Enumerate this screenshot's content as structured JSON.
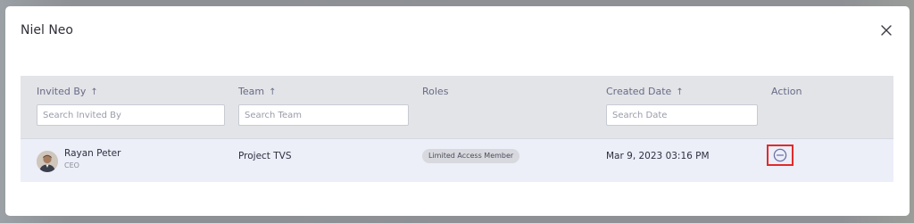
{
  "modal": {
    "title": "Niel Neo",
    "close_icon": "close-icon"
  },
  "table": {
    "columns": [
      {
        "label": "Invited By",
        "sortable": true,
        "sort_icon": "↑"
      },
      {
        "label": "Team",
        "sortable": true,
        "sort_icon": "↑"
      },
      {
        "label": "Roles",
        "sortable": false
      },
      {
        "label": "Created Date",
        "sortable": true,
        "sort_icon": "↑"
      },
      {
        "label": "Action",
        "sortable": false
      }
    ],
    "filters": {
      "invited_by_placeholder": "Search Invited By",
      "team_placeholder": "Search Team",
      "date_placeholder": "Search Date"
    },
    "rows": [
      {
        "name": "Rayan Peter",
        "title": "CEO",
        "team": "Project TVS",
        "role": "Limited Access Member",
        "created": "Mar 9, 2023 03:16 PM",
        "action_icon": "remove-circle-icon"
      }
    ]
  },
  "colors": {
    "header_bg": "#e3e4e8",
    "row_bg": "#eceef8",
    "highlight": "#e02b2b",
    "accent_icon": "#6d70a6"
  }
}
